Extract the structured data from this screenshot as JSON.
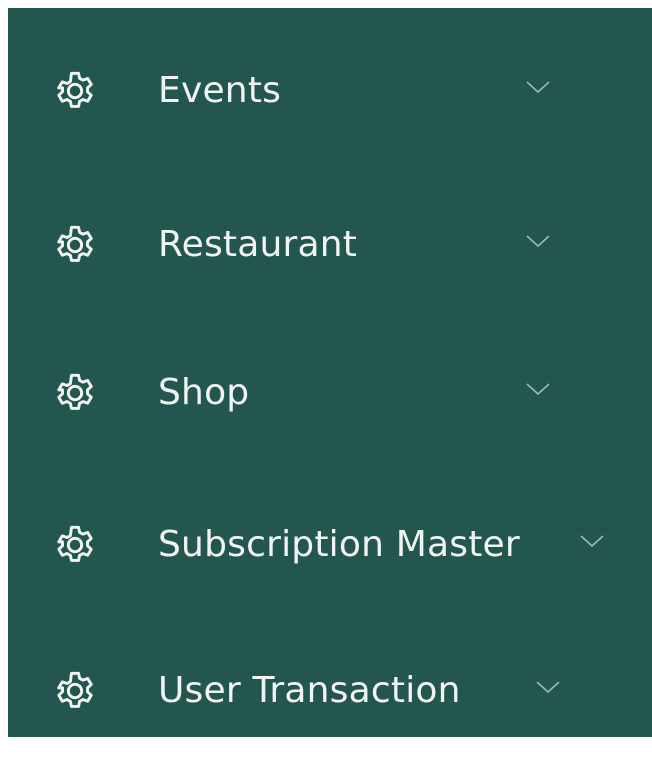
{
  "sidebar": {
    "items": [
      {
        "label": "Events",
        "icon": "gear-icon",
        "expand_icon": "chevron-down-icon"
      },
      {
        "label": "Restaurant",
        "icon": "gear-icon",
        "expand_icon": "chevron-down-icon"
      },
      {
        "label": "Shop",
        "icon": "gear-icon",
        "expand_icon": "chevron-down-icon"
      },
      {
        "label": "Subscription Master",
        "icon": "gear-icon",
        "expand_icon": "chevron-down-icon"
      },
      {
        "label": "User Transaction",
        "icon": "gear-icon",
        "expand_icon": "chevron-down-icon"
      }
    ]
  },
  "colors": {
    "sidebar_background": "#22564f",
    "text": "#f1f4f3",
    "icon_stroke": "#f1f4f3",
    "chevron": "#9fb8b3"
  }
}
